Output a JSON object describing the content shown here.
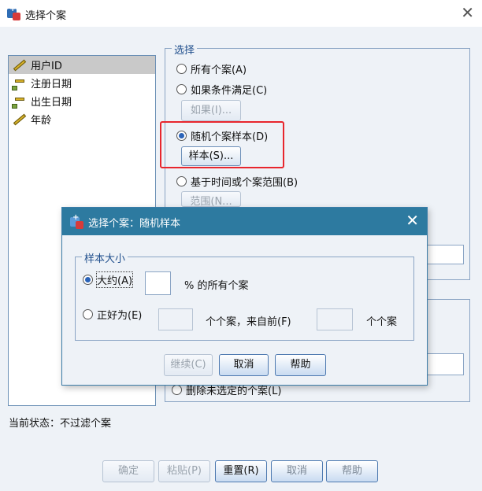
{
  "window": {
    "title": "选择个案"
  },
  "variables": [
    {
      "label": "用户ID",
      "icon": "ruler-icon"
    },
    {
      "label": "注册日期",
      "icon": "calendar-ruler-icon"
    },
    {
      "label": "出生日期",
      "icon": "calendar-ruler-icon"
    },
    {
      "label": "年龄",
      "icon": "ruler-icon"
    }
  ],
  "select_group": {
    "legend": "选择",
    "options": {
      "all_cases": "所有个案(A)",
      "if_condition": "如果条件满足(C)",
      "random_sample": "随机个案样本(D)",
      "time_range": "基于时间或个案范围(B)"
    },
    "if_button": "如果(I)...",
    "sample_button": "样本(S)...",
    "range_button": "范围(N..."
  },
  "output_group": {
    "delete_option": "删除未选定的个案(L)"
  },
  "status": "当前状态：不过滤个案",
  "footer_buttons": {
    "ok": "确定",
    "paste": "粘贴(P)",
    "reset": "重置(R)",
    "cancel": "取消",
    "help": "帮助"
  },
  "modal": {
    "title": "选择个案：随机样本",
    "group_legend": "样本大小",
    "approx_label": "大约(A)",
    "approx_value": "",
    "percent_label": "% 的所有个案",
    "exact_label": "正好为(E)",
    "exact_value": "",
    "cases_from_label": "个个案，来自前(F)",
    "first_value": "",
    "cases_label": "个个案",
    "continue_button": "继续(C)",
    "cancel_button": "取消",
    "help_button": "帮助"
  }
}
